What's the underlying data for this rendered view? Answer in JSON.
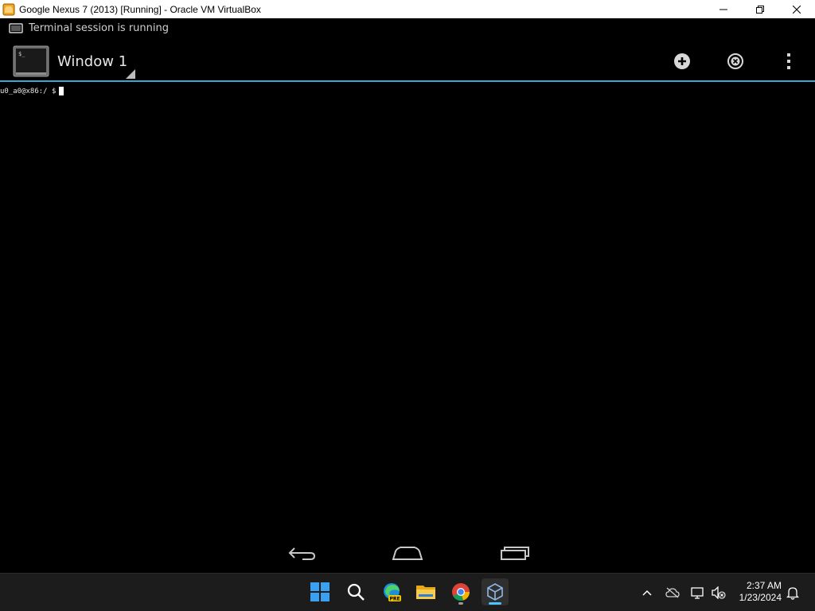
{
  "window": {
    "title": "Google Nexus 7 (2013) [Running] - Oracle VM VirtualBox",
    "controls": [
      "minimize",
      "restore",
      "close"
    ]
  },
  "android": {
    "statusbar": {
      "notification_icon": "screen-icon",
      "notification_text": "Terminal session is running"
    },
    "actionbar": {
      "app_icon": "terminal-icon",
      "window_title": "Window 1",
      "actions": [
        "new-window-icon",
        "close-window-icon",
        "overflow-menu-icon"
      ],
      "accent_color": "#35a8d6"
    },
    "terminal": {
      "prompt": "u0_a0@x86:/ $"
    },
    "navbar": [
      "back-icon",
      "home-icon",
      "recents-icon"
    ]
  },
  "taskbar": {
    "apps": [
      "windows-start-icon",
      "search-icon",
      "edge-preview-icon",
      "file-explorer-icon",
      "chrome-icon",
      "virtualbox-icon"
    ],
    "edge_badge": "PRE",
    "tray": [
      "chevron-up-icon",
      "onedrive-icon",
      "network-icon",
      "volume-muted-icon",
      "notifications-icon"
    ],
    "clock": {
      "time": "2:37 AM",
      "date": "1/23/2024"
    }
  }
}
